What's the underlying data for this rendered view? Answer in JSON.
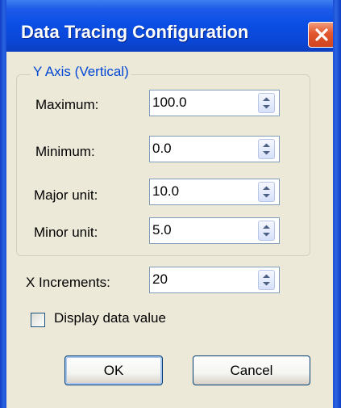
{
  "dialog": {
    "title": "Data Tracing Configuration",
    "close_icon": "close-x-icon"
  },
  "y_axis": {
    "group_label": "Y Axis (Vertical)",
    "fields": [
      {
        "label": "Maximum:",
        "value": "100.0"
      },
      {
        "label": "Minimum:",
        "value": "0.0"
      },
      {
        "label": "Major unit:",
        "value": "10.0"
      },
      {
        "label": "Minor unit:",
        "value": "5.0"
      }
    ]
  },
  "x_increments": {
    "label": "X Increments:",
    "value": "20"
  },
  "display_data_value": {
    "label": "Display data value",
    "checked": false
  },
  "buttons": {
    "ok": "OK",
    "cancel": "Cancel"
  },
  "colors": {
    "titlebar": "#0a46d6",
    "client_bg": "#ece9d8",
    "group_label": "#0046d5",
    "close_button": "#e2562e"
  }
}
